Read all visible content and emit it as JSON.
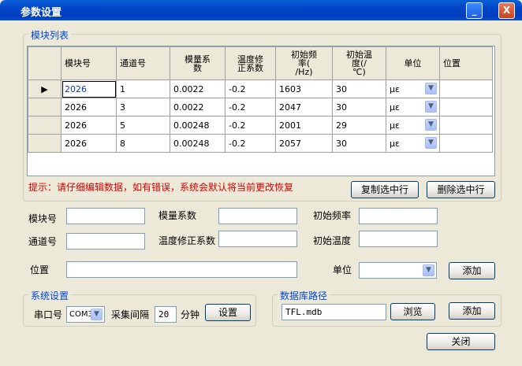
{
  "window": {
    "title": "参数设置",
    "minimize_label": "_",
    "close_label": "X"
  },
  "module_group": {
    "title": "模块列表"
  },
  "grid": {
    "columns": [
      "模块号",
      "通道号",
      "模量系\n数",
      "温度修\n正系数",
      "初始频\n率(\n/Hz)",
      "初始温\n度(/\n℃)",
      "单位",
      "位置"
    ],
    "current_row_marker": "▶",
    "rows": [
      [
        "2026",
        "1",
        "0.0022",
        "-0.2",
        "1603",
        "30",
        "με",
        ""
      ],
      [
        "2026",
        "3",
        "0.0022",
        "-0.2",
        "2047",
        "30",
        "με",
        ""
      ],
      [
        "2026",
        "5",
        "0.00248",
        "-0.2",
        "2001",
        "29",
        "με",
        ""
      ],
      [
        "2026",
        "8",
        "0.00248",
        "-0.2",
        "2057",
        "30",
        "με",
        ""
      ]
    ]
  },
  "hint": "提示：请仔细编辑数据，如有错误，系统会默认将当前更改恢复",
  "buttons": {
    "copy_row": "复制选中行",
    "delete_row": "删除选中行",
    "add": "添加",
    "settings": "设置",
    "browse": "浏览",
    "add_db": "添加",
    "close": "关闭"
  },
  "form": {
    "module_no_label": "模块号",
    "modulus_label": "模量系数",
    "init_freq_label": "初始频率",
    "channel_label": "通道号",
    "temp_coef_label": "温度修正系数",
    "init_temp_label": "初始温度",
    "position_label": "位置",
    "unit_label": "单位",
    "module_no": "",
    "modulus": "",
    "init_freq": "",
    "channel": "",
    "temp_coef": "",
    "init_temp": "",
    "position": "",
    "unit": ""
  },
  "system": {
    "title": "系统设置",
    "port_label": "串口号",
    "port_value": "COM3",
    "interval_label": "采集间隔",
    "interval_value": "20",
    "interval_unit": "分钟"
  },
  "database": {
    "title": "数据库路径",
    "path": "TFL.mdb"
  },
  "colors": {
    "title_bar": "#0046c8",
    "group_title": "#0046d5",
    "hint": "#d80000",
    "face": "#ece9d8"
  },
  "icons": {
    "dropdown": "chevron-down-icon",
    "row_pointer": "row-pointer-icon"
  }
}
